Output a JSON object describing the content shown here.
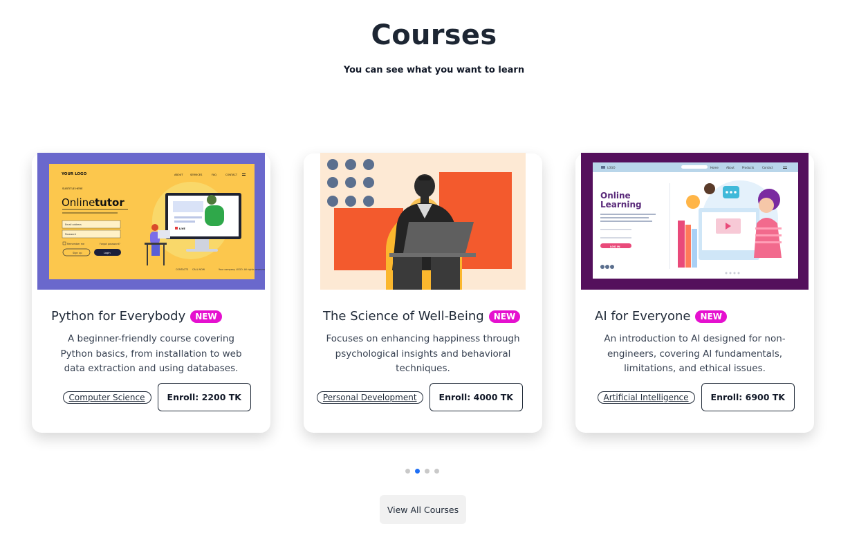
{
  "header": {
    "title": "Courses",
    "subtitle": "You can see what you want to learn"
  },
  "courses": [
    {
      "title": "Python for Everybody",
      "badge": "NEW",
      "description": "A beginner-friendly course covering Python basics, from installation to web data extraction and using databases.",
      "category": "Computer Science",
      "enroll_label": "Enroll: 2200 TK",
      "image": {
        "logo": "YOUR LOGO",
        "nav": [
          "ABOUT",
          "SERVICES",
          "FAQ",
          "CONTACT"
        ],
        "kicker": "SUBTITLE HERE",
        "headline_a": "Online",
        "headline_b": "tutor",
        "email_label": "Email address",
        "password_label": "Password",
        "remember": "Remember me",
        "forgot": "Forgot password?",
        "signup": "Sign up",
        "login": "Login",
        "live": "LIVE"
      }
    },
    {
      "title": "The Science of Well-Being",
      "badge": "NEW",
      "description": "Focuses on enhancing happiness through psychological insights and behavioral techniques.",
      "category": "Personal Development",
      "enroll_label": "Enroll: 4000 TK"
    },
    {
      "title": "AI for Everyone",
      "badge": "NEW",
      "description": "An introduction to AI designed for non-engineers, covering AI fundamentals, limitations, and ethical issues.",
      "category": "Artificial Intelligence",
      "enroll_label": "Enroll: 6900 TK",
      "image": {
        "logo": "LOGO",
        "nav": [
          "Home",
          "About",
          "Products",
          "Contact"
        ],
        "headline_a": "Online",
        "headline_b": "Learning",
        "login": "LOG IN"
      }
    }
  ],
  "carousel": {
    "count": 4,
    "active_index": 1
  },
  "view_all_label": "View All Courses",
  "colors": {
    "badge": "#e510cf",
    "dot_active": "#1e6ff5",
    "card1_bg": "#6a68cc",
    "card1_panel": "#fcc74d",
    "card2_bg": "#fde9d4",
    "card2_accent": "#f35a2d",
    "card3_bg": "#54105c"
  }
}
